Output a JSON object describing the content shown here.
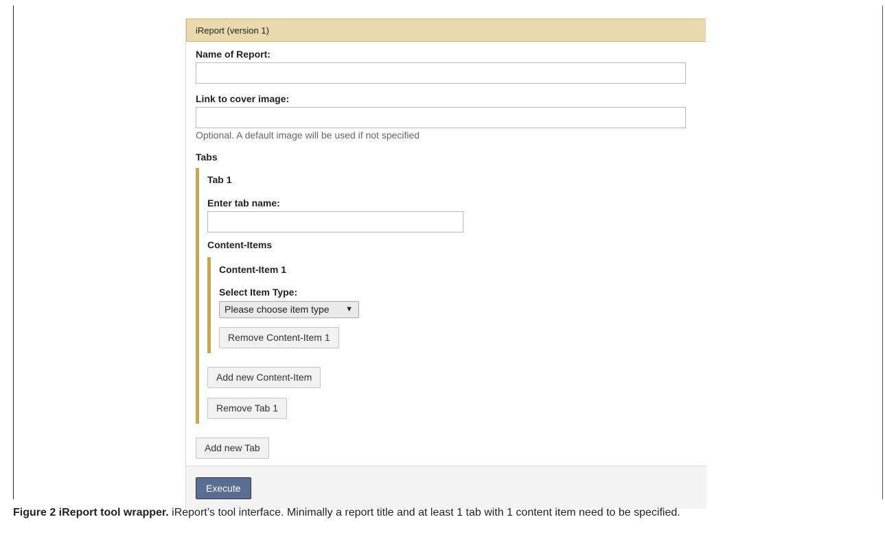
{
  "panel": {
    "title": "iReport (version 1)"
  },
  "form": {
    "report_name_label": "Name of Report:",
    "report_name_value": "",
    "cover_label": "Link to cover image:",
    "cover_value": "",
    "cover_hint": "Optional. A default image will be used if not specified",
    "tabs_label": "Tabs"
  },
  "tab": {
    "title": "Tab 1",
    "name_label": "Enter tab name:",
    "name_value": "",
    "content_items_label": "Content-Items",
    "remove_label": "Remove Tab 1",
    "add_item_label": "Add new Content-Item"
  },
  "content_item": {
    "title": "Content-Item 1",
    "type_label": "Select Item Type:",
    "type_selected": "Please choose item type",
    "type_arrow": "▼",
    "remove_label": "Remove Content-Item 1"
  },
  "actions": {
    "add_tab_label": "Add new Tab",
    "execute_label": "Execute"
  },
  "caption": {
    "title": "Figure 2 iReport tool wrapper.",
    "text": " iReport’s tool interface. Minimally a report title and at least 1 tab with 1 content item need to be specified."
  },
  "colors": {
    "header_bg": "#ead9ad",
    "section_bar": "#c9a652",
    "execute_bg": "#5c6d92"
  }
}
